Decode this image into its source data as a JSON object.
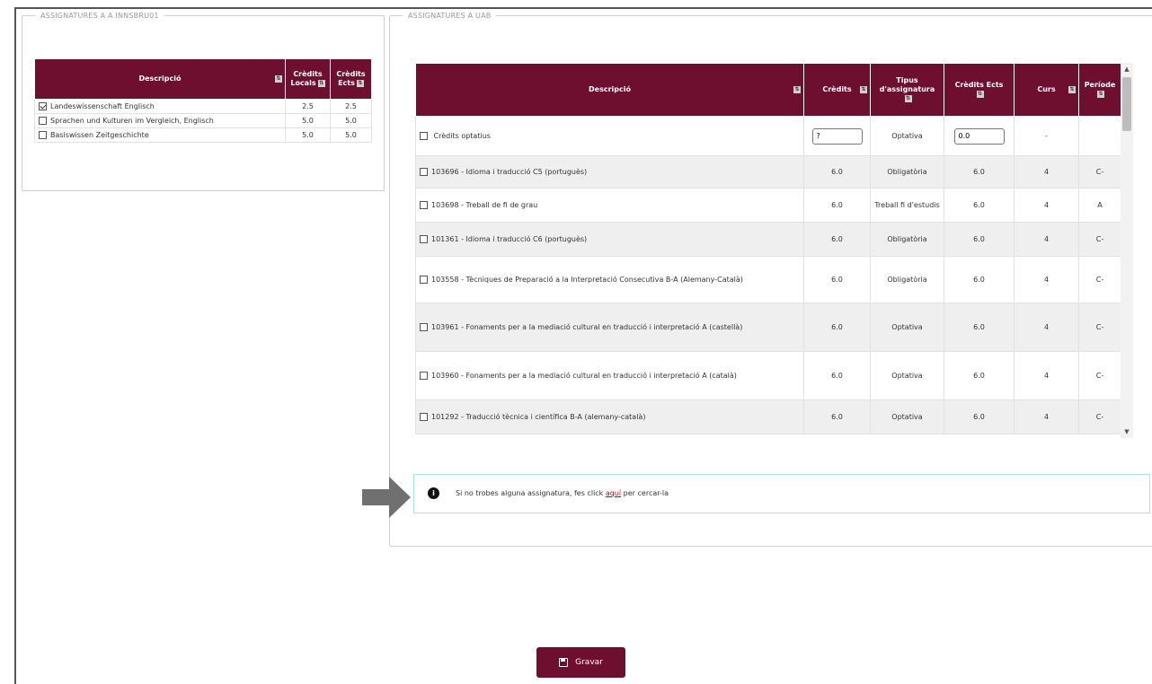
{
  "left_panel": {
    "legend": "ASSIGNATURES A A INNSBRU01",
    "headers": {
      "descripcio": "Descripció",
      "credits_locals": "Crèdits Locals",
      "credits_ects": "Crèdits Ects"
    },
    "rows": [
      {
        "checked": true,
        "descripcio": "Landeswissenschaft Englisch",
        "credits_locals": "2.5",
        "credits_ects": "2.5"
      },
      {
        "checked": false,
        "descripcio": "Sprachen und Kulturen im Vergleich, Englisch",
        "credits_locals": "5.0",
        "credits_ects": "5.0"
      },
      {
        "checked": false,
        "descripcio": "Basiswissen Zeitgeschichte",
        "credits_locals": "5.0",
        "credits_ects": "5.0"
      }
    ]
  },
  "right_panel": {
    "legend": "ASSIGNATURES A UAB",
    "headers": {
      "descripcio": "Descripció",
      "credits": "Crèdits",
      "tipus": "Tipus d'assignatura",
      "credits_ects": "Crèdits Ects",
      "curs": "Curs",
      "periode": "Període"
    },
    "optional_row": {
      "descripcio": "Crèdits optatius",
      "credits_value": "?",
      "tipus": "Optativa",
      "ects_value": "0.0",
      "curs": "-",
      "periode": ""
    },
    "rows": [
      {
        "descripcio": "103696 - Idioma i traducció C5 (portuguès)",
        "credits": "6.0",
        "tipus": "Obligatòria",
        "ects": "6.0",
        "curs": "4",
        "periode": "C-"
      },
      {
        "descripcio": "103698 - Treball de fi de grau",
        "credits": "6.0",
        "tipus": "Treball fi d'estudis",
        "ects": "6.0",
        "curs": "4",
        "periode": "A"
      },
      {
        "descripcio": "101361 - Idioma i traducció C6 (portuguès)",
        "credits": "6.0",
        "tipus": "Obligatòria",
        "ects": "6.0",
        "curs": "4",
        "periode": "C-"
      },
      {
        "descripcio": "103558 - Tècniques de Preparació a la Interpretació Consecutiva B-A (Alemany-Català)",
        "credits": "6.0",
        "tipus": "Obligatòria",
        "ects": "6.0",
        "curs": "4",
        "periode": "C-"
      },
      {
        "descripcio": "103961 - Fonaments per a la mediació cultural en traducció i interpretació A (castellà)",
        "credits": "6.0",
        "tipus": "Optativa",
        "ects": "6.0",
        "curs": "4",
        "periode": "C-"
      },
      {
        "descripcio": "103960 - Fonaments per a la mediació cultural en traducció i interpretació A (català)",
        "credits": "6.0",
        "tipus": "Optativa",
        "ects": "6.0",
        "curs": "4",
        "periode": "C-"
      },
      {
        "descripcio": "101292 - Traducció tècnica i científica B-A (alemany-català)",
        "credits": "6.0",
        "tipus": "Optativa",
        "ects": "6.0",
        "curs": "4",
        "periode": "C-"
      }
    ]
  },
  "info": {
    "text_before": "Si no trobes alguna assignatura, fes click ",
    "link": "aquí",
    "text_after": " per cercar-la"
  },
  "save_button": {
    "label": "Gravar"
  },
  "colors": {
    "header_bg": "#6e0f2f",
    "info_border": "#a9e3ea",
    "link": "#cc0000"
  }
}
